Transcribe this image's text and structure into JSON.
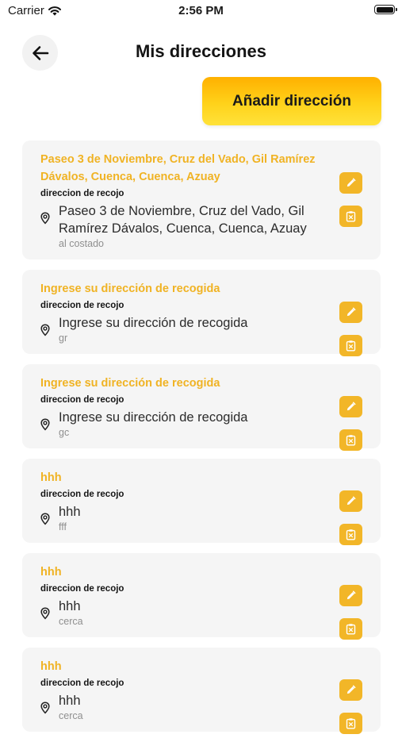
{
  "status": {
    "carrier": "Carrier",
    "time": "2:56 PM"
  },
  "header": {
    "title": "Mis direcciones"
  },
  "add_button_label": "Añadir dirección",
  "addresses": [
    {
      "title": "Paseo 3 de Noviembre, Cruz del Vado, Gil Ramírez Dávalos, Cuenca, Cuenca, Azuay",
      "type": "direccion de recojo",
      "address": "Paseo 3 de Noviembre, Cruz del Vado, Gil Ramírez Dávalos, Cuenca, Cuenca, Azuay",
      "reference": "al costado"
    },
    {
      "title": "Ingrese su dirección de recogida",
      "type": "direccion de recojo",
      "address": "Ingrese su dirección de recogida",
      "reference": "gr"
    },
    {
      "title": "Ingrese su dirección de recogida",
      "type": "direccion de recojo",
      "address": "Ingrese su dirección de recogida",
      "reference": "gc"
    },
    {
      "title": "hhh",
      "type": "direccion de recojo",
      "address": "hhh",
      "reference": "fff"
    },
    {
      "title": "hhh",
      "type": "direccion de recojo",
      "address": "hhh",
      "reference": "cerca"
    },
    {
      "title": "hhh",
      "type": "direccion de recojo",
      "address": "hhh",
      "reference": "cerca"
    }
  ]
}
